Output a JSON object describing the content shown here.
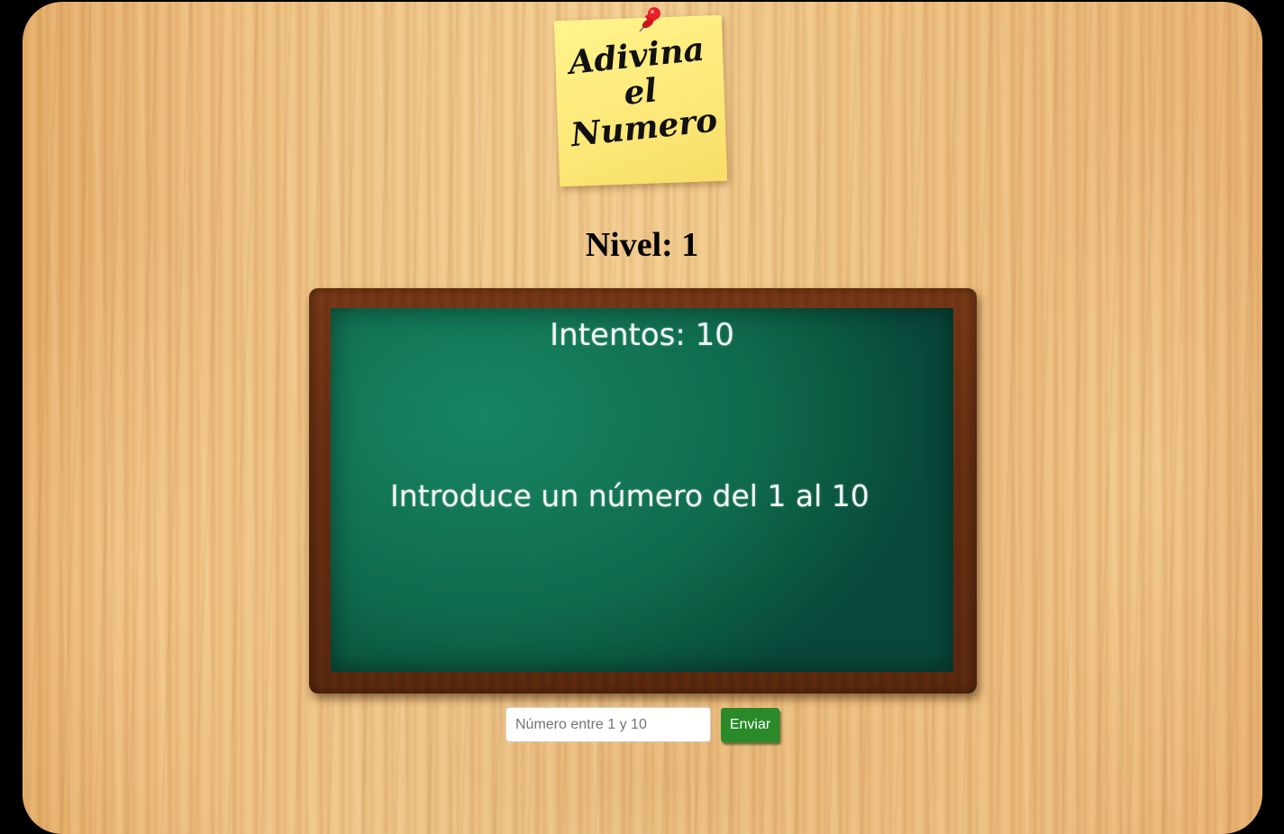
{
  "header": {
    "logo_text": "Adivina\nel\nNumero"
  },
  "game": {
    "level_label": "Nivel: 1",
    "attempts_label": "Intentos: 10",
    "message": "Introduce un número del 1 al 10"
  },
  "form": {
    "input_placeholder": "Número entre 1 y 10",
    "input_value": "",
    "submit_label": "Enviar"
  },
  "colors": {
    "chalkboard": "#137858",
    "submit_button": "#2a8a2a",
    "sticky_note": "#fde97a",
    "pin": "#e8202a"
  },
  "icons": {
    "pin": "push-pin-icon"
  }
}
